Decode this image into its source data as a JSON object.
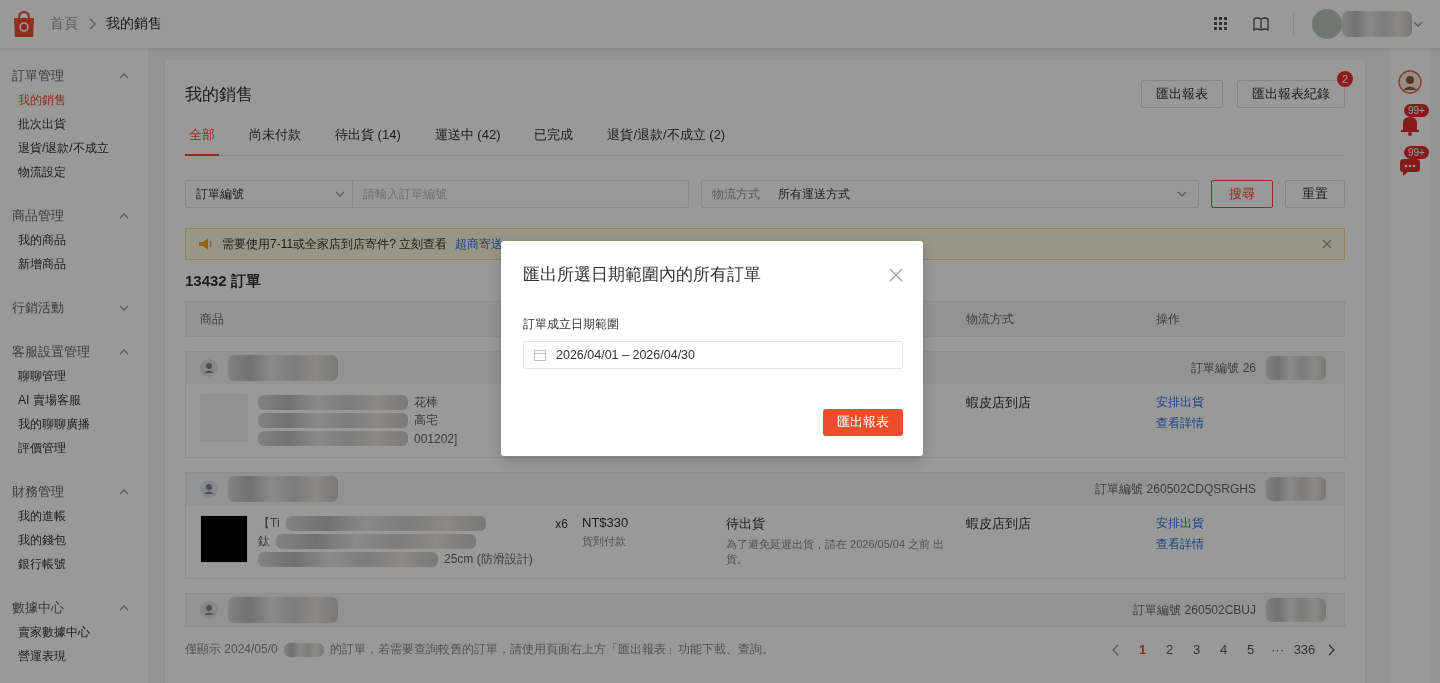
{
  "header": {
    "breadcrumb": [
      "首頁",
      "我的銷售"
    ]
  },
  "sidebar": {
    "groups": [
      {
        "title": "訂單管理",
        "expanded": true,
        "items": [
          {
            "label": "我的銷售",
            "selected": true
          },
          {
            "label": "批次出貨",
            "selected": false
          },
          {
            "label": "退貨/退款/不成立",
            "selected": false
          },
          {
            "label": "物流設定",
            "selected": false
          }
        ]
      },
      {
        "title": "商品管理",
        "expanded": true,
        "items": [
          {
            "label": "我的商品",
            "selected": false
          },
          {
            "label": "新增商品",
            "selected": false
          }
        ]
      },
      {
        "title": "行銷活動",
        "expanded": false
      },
      {
        "title": "客服設置管理",
        "expanded": true,
        "items": [
          {
            "label": "聊聊管理",
            "selected": false
          },
          {
            "label": "AI 賣場客服",
            "selected": false
          },
          {
            "label": "我的聊聊廣播",
            "selected": false
          },
          {
            "label": "評價管理",
            "selected": false
          }
        ]
      },
      {
        "title": "財務管理",
        "expanded": true,
        "items": [
          {
            "label": "我的進帳",
            "selected": false
          },
          {
            "label": "我的錢包",
            "selected": false
          },
          {
            "label": "銀行帳號",
            "selected": false
          }
        ]
      },
      {
        "title": "數據中心",
        "expanded": true,
        "items": [
          {
            "label": "賣家數據中心",
            "selected": false
          },
          {
            "label": "營運表現",
            "selected": false
          }
        ]
      }
    ]
  },
  "page": {
    "title": "我的銷售",
    "buttons": [
      {
        "label": "匯出報表"
      },
      {
        "label": "匯出報表紀錄",
        "badge": "2"
      }
    ]
  },
  "tabs": [
    {
      "label": "全部",
      "selected": true
    },
    {
      "label": "尚未付款",
      "selected": false
    },
    {
      "label": "待出貨 (14)",
      "selected": false
    },
    {
      "label": "運送中 (42)",
      "selected": false
    },
    {
      "label": "已完成",
      "selected": false
    },
    {
      "label": "退貨/退款/不成立 (2)",
      "selected": false
    }
  ],
  "filters": {
    "field_select": "訂單編號",
    "search": {
      "placeholder": "請輸入訂單編號"
    },
    "shipping_label": "物流方式",
    "shipping_value": "所有運送方式",
    "search_button": "搜尋",
    "reset_button": "重置"
  },
  "notice": {
    "text": "需要使用7-11或全家店到店寄件? 立刻查看",
    "link": "超商寄送"
  },
  "order_count": "13432 訂單",
  "table": {
    "columns": [
      "商品",
      "物流方式",
      "操作"
    ],
    "orders": [
      {
        "number": "訂單編號 26",
        "product_lines": [
          "花棒",
          "高宅",
          "001202]"
        ],
        "shipping": "蝦皮店到店",
        "actions": [
          "安排出貨",
          "查看詳情"
        ]
      },
      {
        "number": "訂單編號 260502CDQSRGHS",
        "product_lines": [
          "【Ti",
          "鈦",
          "25cm (防滑設計)"
        ],
        "quantity": "x6",
        "price": "NT$330",
        "payment": "貨到付款",
        "status": "待出貨",
        "status_note": "為了避免延遲出貨，請在 2026/05/04 之前 出貨。",
        "shipping": "蝦皮店到店",
        "actions": [
          "安排出貨",
          "查看詳情"
        ]
      },
      {
        "number": "訂單編號 260502CBUJ"
      }
    ]
  },
  "footer_note": [
    "僅顯示 2024/05/0",
    "的訂單，若需要查詢較舊的訂單，請使用頁面右上方「匯出報表」功能下載、查詢。"
  ],
  "pagination": {
    "pages": [
      {
        "label": "1",
        "selected": true
      },
      {
        "label": "2",
        "selected": false
      },
      {
        "label": "3",
        "selected": false
      },
      {
        "label": "4",
        "selected": false
      },
      {
        "label": "5",
        "selected": false
      },
      {
        "label": "···",
        "selected": false
      },
      {
        "label": "336",
        "selected": false
      }
    ]
  },
  "rail": {
    "notification_badge": "99+",
    "chat_badge": "99+"
  },
  "modal": {
    "title": "匯出所選日期範圍內的所有訂單",
    "field_label": "訂單成立日期範圍",
    "date_range": "2026/04/01 – 2026/04/30",
    "button": "匯出報表"
  }
}
